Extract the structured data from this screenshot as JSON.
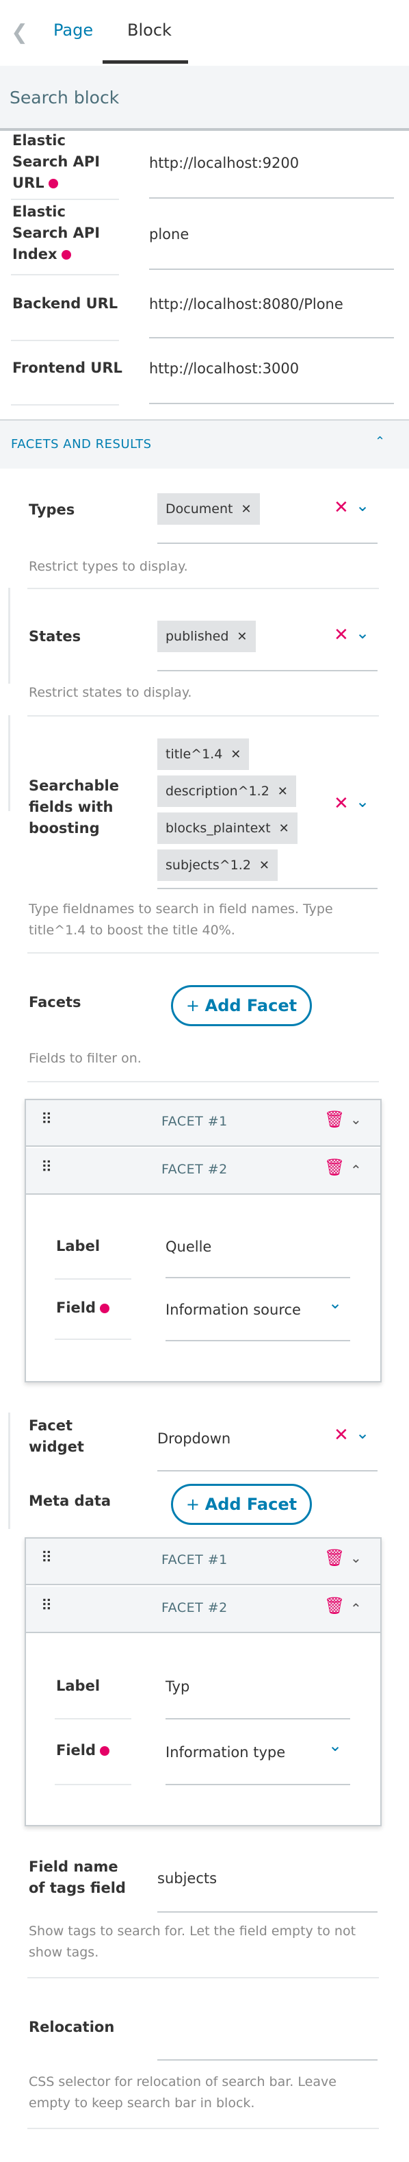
{
  "tabs": {
    "back_icon": "chevron-left-icon",
    "page": "Page",
    "block": "Block"
  },
  "block_title": "Search block",
  "fields": {
    "es_url": {
      "label_l1": "Elastic",
      "label_l2": "Search API",
      "label_l3": "URL",
      "value": "http://localhost:9200"
    },
    "es_index": {
      "label_l1": "Elastic",
      "label_l2": "Search API",
      "label_l3": "Index",
      "value": "plone"
    },
    "backend_url": {
      "label": "Backend URL",
      "value": "http://localhost:8080/Plone"
    },
    "frontend_url": {
      "label": "Frontend URL",
      "value": "http://localhost:3000"
    }
  },
  "section": {
    "title": "FACETS AND RESULTS"
  },
  "types": {
    "label": "Types",
    "chips": [
      "Document"
    ],
    "help": "Restrict types to display."
  },
  "states": {
    "label": "States",
    "chips": [
      "published"
    ],
    "help": "Restrict states to display."
  },
  "searchable": {
    "label_l1": "Searchable",
    "label_l2": "fields with",
    "label_l3": "boosting",
    "chips": [
      "title^1.4",
      "description^1.2",
      "blocks_plaintext",
      "subjects^1.2"
    ],
    "help_l1": "Type fieldnames to search in field names. Type",
    "help_l2": "title^1.4 to boost the title 40%."
  },
  "facets": {
    "label": "Facets",
    "add_label": "Add Facet",
    "help": "Fields to filter on.",
    "items": [
      {
        "title": "FACET #1"
      },
      {
        "title": "FACET #2",
        "label_label": "Label",
        "label_value": "Quelle",
        "field_label": "Field",
        "field_value": "Information source"
      }
    ]
  },
  "facet_widget": {
    "label_l1": "Facet",
    "label_l2": "widget",
    "value": "Dropdown"
  },
  "meta": {
    "label": "Meta data",
    "add_label": "Add Facet",
    "items": [
      {
        "title": "FACET #1"
      },
      {
        "title": "FACET #2",
        "label_label": "Label",
        "label_value": "Typ",
        "field_label": "Field",
        "field_value": "Information type"
      }
    ]
  },
  "tags_field": {
    "label_l1": "Field name",
    "label_l2": "of tags field",
    "value": "subjects",
    "help_l1": "Show tags to search for. Let the field empty to not",
    "help_l2": "show tags."
  },
  "relocation": {
    "label": "Relocation",
    "value": "",
    "help_l1": "CSS selector for relocation of search bar. Leave",
    "help_l2": "empty to keep search bar in block."
  },
  "colors": {
    "accent": "#007eb1",
    "required": "#e40166",
    "muted": "#4c6f7a"
  }
}
